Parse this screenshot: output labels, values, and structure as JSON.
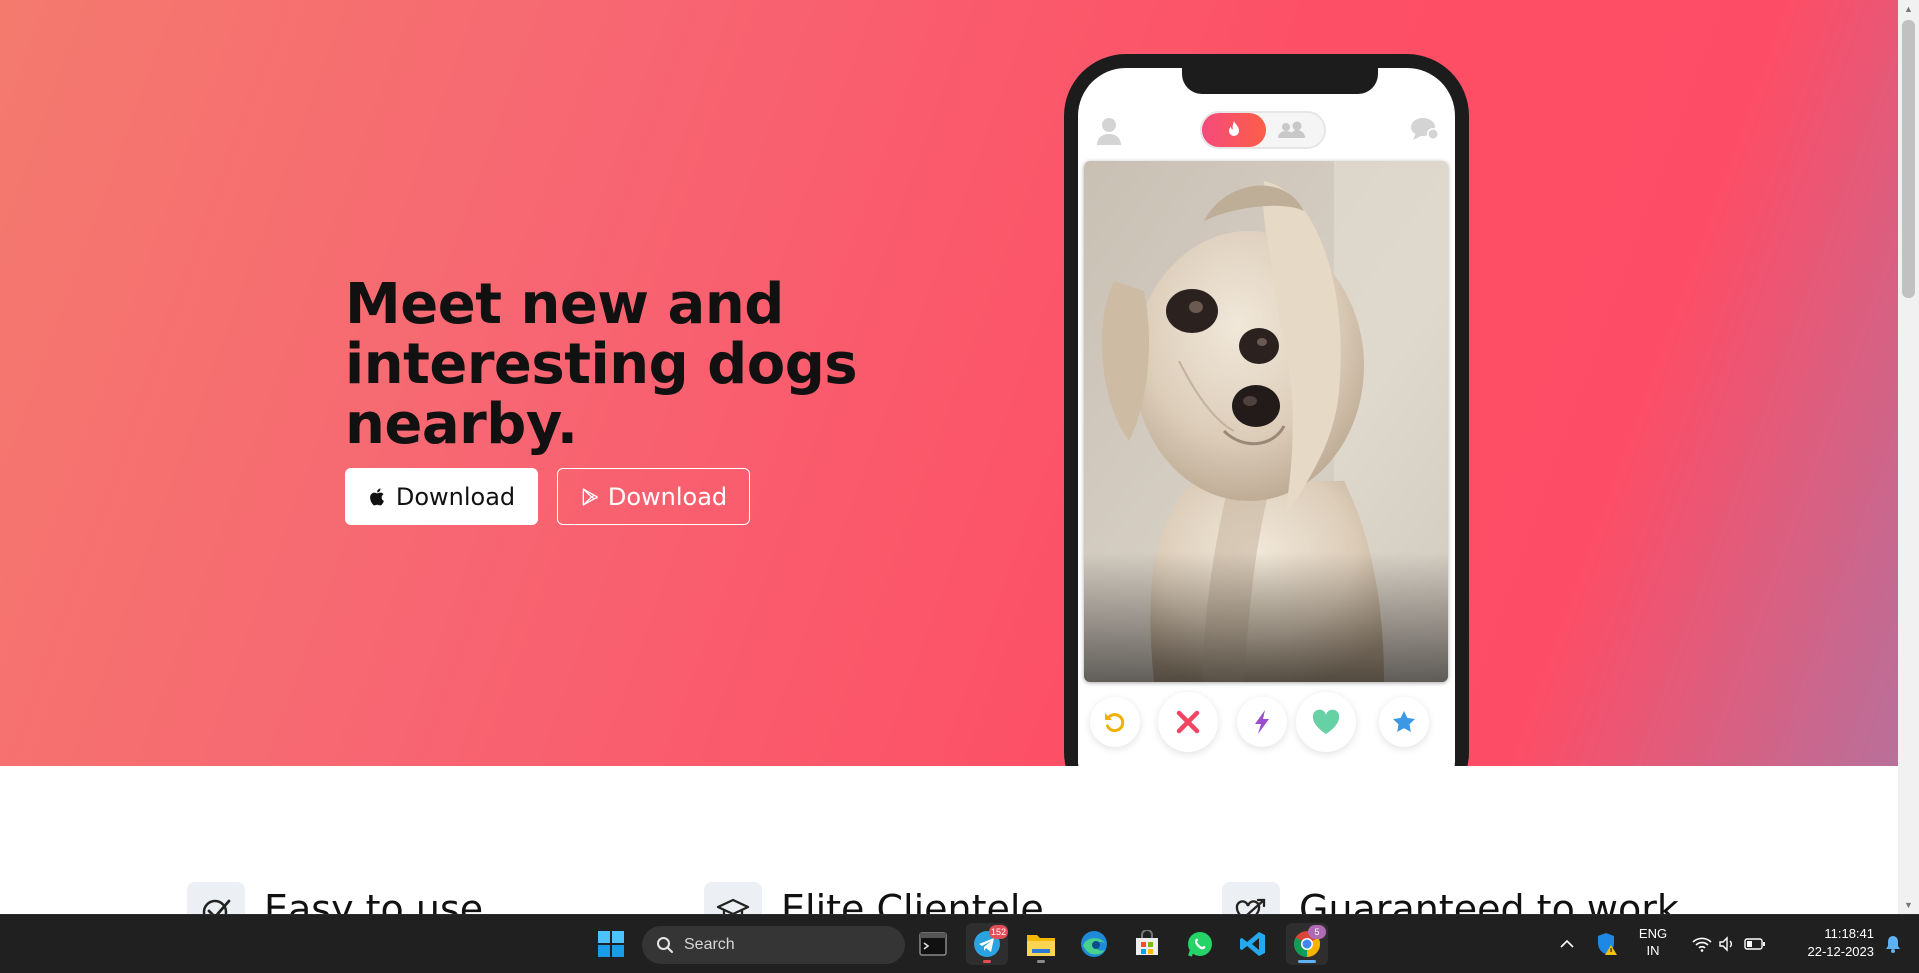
{
  "hero": {
    "headline": [
      "Meet new and",
      "interesting dogs",
      "nearby."
    ],
    "download_apple_label": "Download",
    "download_play_label": "Download",
    "gradient_colors": [
      "#f47a6e",
      "#fd4f66",
      "#b8709a"
    ]
  },
  "phone_app": {
    "tabs": [
      "swipe-flame",
      "group"
    ],
    "photo_subject": "small white dog",
    "actions": [
      "rewind",
      "nope",
      "boost",
      "like",
      "super-like"
    ]
  },
  "features": [
    {
      "icon": "check-badge-icon",
      "title": "Easy to use."
    },
    {
      "icon": "graduation-cap-icon",
      "title": "Elite Clientele."
    },
    {
      "icon": "heart-arrow-icon",
      "title": "Guaranteed to work."
    }
  ],
  "taskbar": {
    "search_placeholder": "Search",
    "telegram_badge": "152",
    "chrome_badge": "5",
    "language_line1": "ENG",
    "language_line2": "IN",
    "time": "11:18:41",
    "date": "22-12-2023"
  }
}
